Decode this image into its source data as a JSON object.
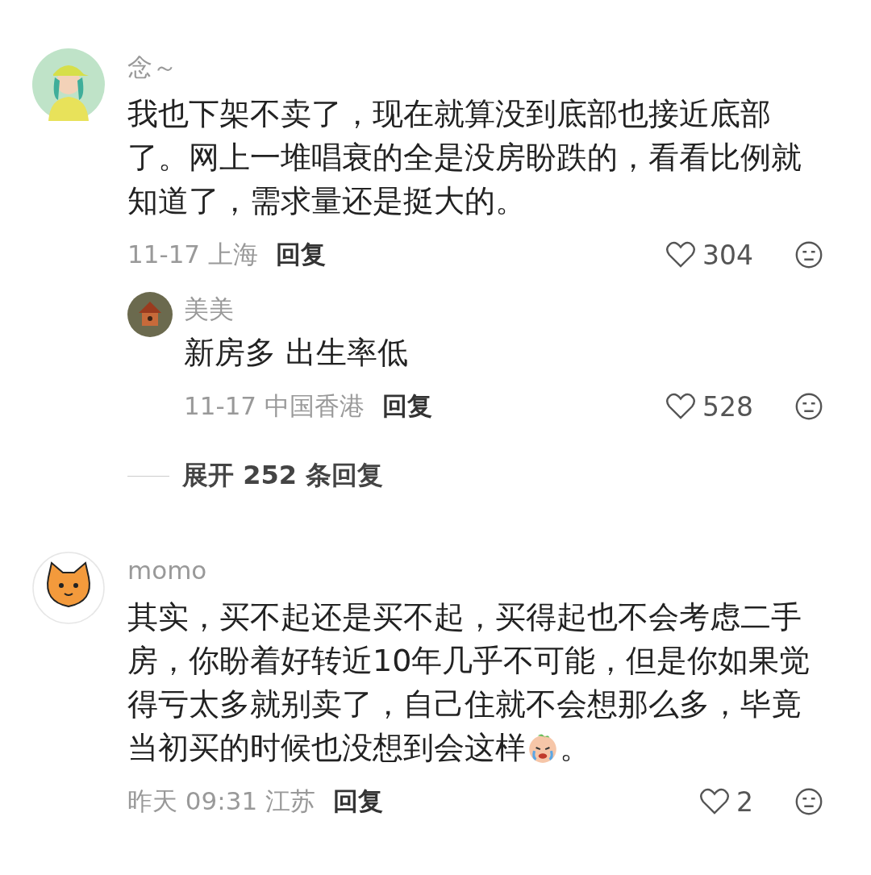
{
  "comments": [
    {
      "name": "念～",
      "segments": [
        {
          "kind": "text",
          "text": "我也下架不卖了，现在就算没到底部也接近底部了。网上一堆唱衰的全是没房盼跌的，看看比例就知道了，需求量还是挺大的。"
        }
      ],
      "date": "11-17",
      "location": "上海",
      "reply_label": "回复",
      "likes": "304",
      "replies": [
        {
          "name": "美美",
          "segments": [
            {
              "kind": "text",
              "text": "新房多 出生率低"
            }
          ],
          "date": "11-17",
          "location": "中国香港",
          "reply_label": "回复",
          "likes": "528"
        }
      ],
      "expand_label": "展开 252 条回复"
    },
    {
      "name": "momo",
      "segments": [
        {
          "kind": "text",
          "text": "其实，买不起还是买不起，买得起也不会考虑二手房，你盼着好转近10年几乎不可能，但是你如果觉得亏太多就别卖了，自己住就不会想那么多，毕竟"
        },
        {
          "kind": "text",
          "text": "当初买的时候也没想到会这样"
        },
        {
          "kind": "emoji"
        },
        {
          "kind": "text",
          "text": "。"
        }
      ],
      "date": "昨天 09:31",
      "location": "江苏",
      "reply_label": "回复",
      "likes": "2"
    }
  ]
}
